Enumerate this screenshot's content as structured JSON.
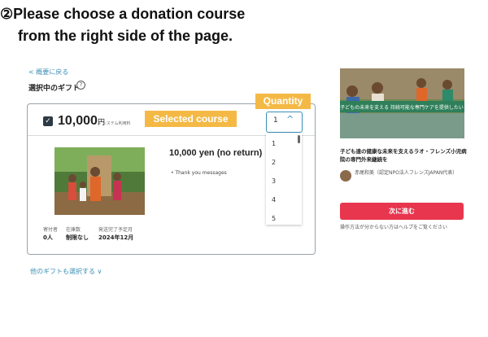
{
  "instruction": {
    "line1": "②Please choose a donation course",
    "line2": "from the right side of the page."
  },
  "nav": {
    "back_link": "< 概要に戻る"
  },
  "gift_section": {
    "heading": "選択中のギフト",
    "help_icon": "question-circle"
  },
  "course_header": {
    "price": "10,000",
    "unit": "円",
    "sub_note": "+ システム利用料",
    "selected_badge": "Selected course",
    "quantity_badge": "Quantity"
  },
  "quantity": {
    "selected": "1",
    "options": [
      "1",
      "2",
      "3",
      "4",
      "5"
    ]
  },
  "course": {
    "title": "10,000 yen (no return)",
    "perks": [
      "• Thank you messages"
    ],
    "stats": [
      {
        "label": "寄付者",
        "value": "0人"
      },
      {
        "label": "在庫数",
        "value": "制限なし"
      },
      {
        "label": "発送完了予定月",
        "value": "2024年12月"
      }
    ]
  },
  "other_gifts": {
    "label": "他のギフトも選択する ∨"
  },
  "sidebar": {
    "thumb_caption": "子どもの未来を支える 持続可能な専門ケアを提供したい",
    "project_title": "子ども達の健康な未来を支えるラオ・フレンズ小児病院の専門外来継続を",
    "owner": "赤尾和美（認定NPO法人フレンズJAPAN代表）",
    "next_button": "次に進む",
    "help_note": "操作方法が分からない方はヘルプをご覧ください"
  },
  "colors": {
    "accent_badge": "#f4b945",
    "link_blue": "#3a8fb5",
    "next_button": "#e8364e"
  }
}
